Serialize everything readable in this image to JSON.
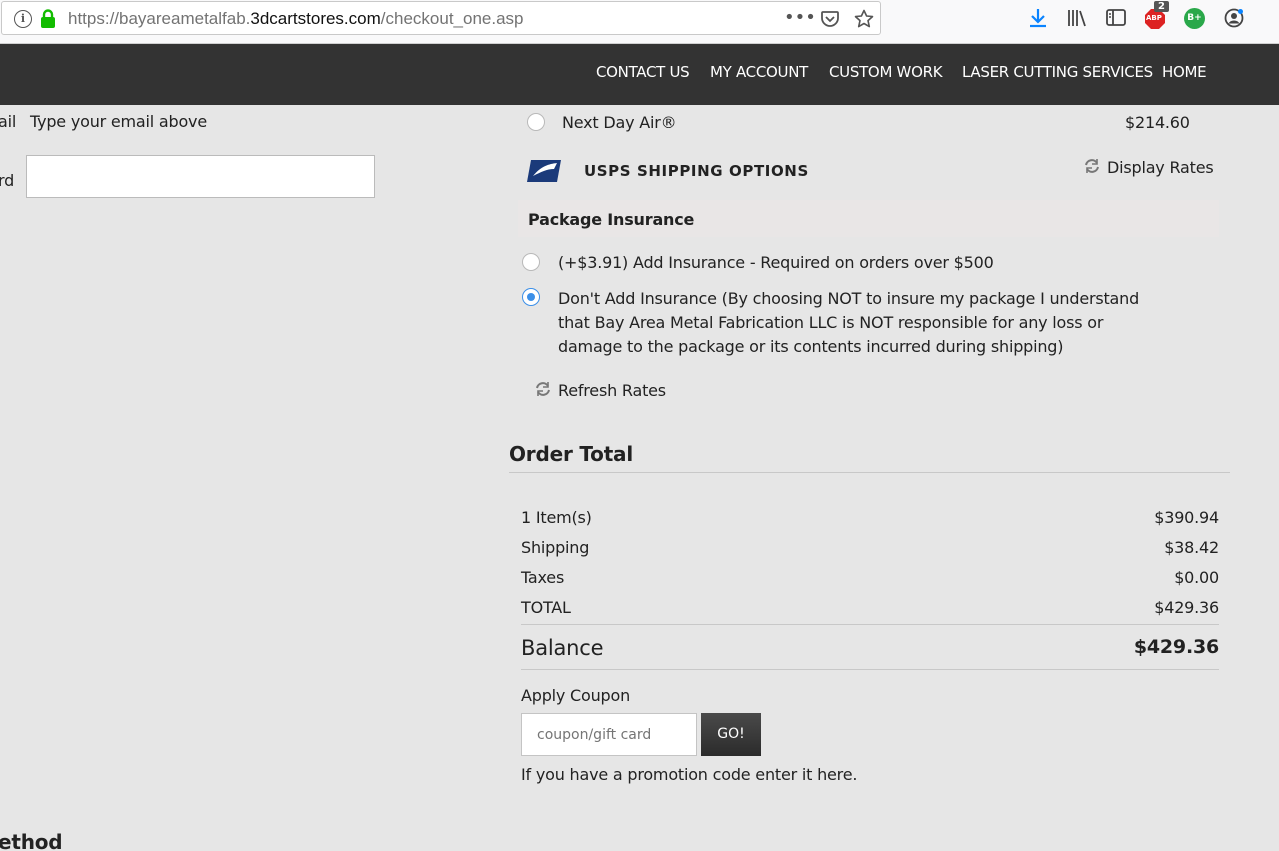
{
  "browser": {
    "url_prefix": "https://bayareametalfab.",
    "url_domain": "3dcartstores.com",
    "url_path": "/checkout_one.asp",
    "more_icon": "•••",
    "abp_badge": "2",
    "abp_label": "ABP",
    "bplus_label": "B+"
  },
  "nav": {
    "items": [
      "CONTACT US",
      "MY ACCOUNT",
      "CUSTOM WORK",
      "LASER CUTTING SERVICES",
      "HOME"
    ]
  },
  "left": {
    "email_label_fragment": "ail",
    "email_hint": "Type your email above",
    "password_label_fragment": "rd",
    "password_value": "",
    "method_heading_fragment": "ethod"
  },
  "shipping": {
    "next_day_label": "Next Day Air®",
    "next_day_price": "$214.60",
    "usps_title": "USPS SHIPPING OPTIONS",
    "display_rates": "Display Rates"
  },
  "insurance": {
    "heading": "Package Insurance",
    "option_add": "(+$3.91) Add Insurance - Required on orders over $500",
    "option_none_lines": [
      "Don't Add Insurance (By choosing NOT to insure my package I understand",
      "that Bay Area Metal Fabrication LLC is NOT responsible for any loss or",
      "damage to the package or its contents incurred during shipping)"
    ],
    "selected": "none",
    "refresh_rates": "Refresh Rates"
  },
  "order_total": {
    "heading": "Order Total",
    "rows": [
      {
        "label": "1 Item(s)",
        "value": "$390.94"
      },
      {
        "label": "Shipping",
        "value": "$38.42"
      },
      {
        "label": "Taxes",
        "value": "$0.00"
      },
      {
        "label": "TOTAL",
        "value": "$429.36"
      }
    ],
    "balance_label": "Balance",
    "balance_value": "$429.36"
  },
  "coupon": {
    "label": "Apply Coupon",
    "placeholder": "coupon/gift card",
    "button": "GO!",
    "hint": "If you have a promotion code enter it here."
  },
  "colors": {
    "nav_bg": "#333333",
    "page_bg": "#e6e6e6",
    "radio_selected": "#3b8fe8",
    "go_button": "#333333"
  }
}
